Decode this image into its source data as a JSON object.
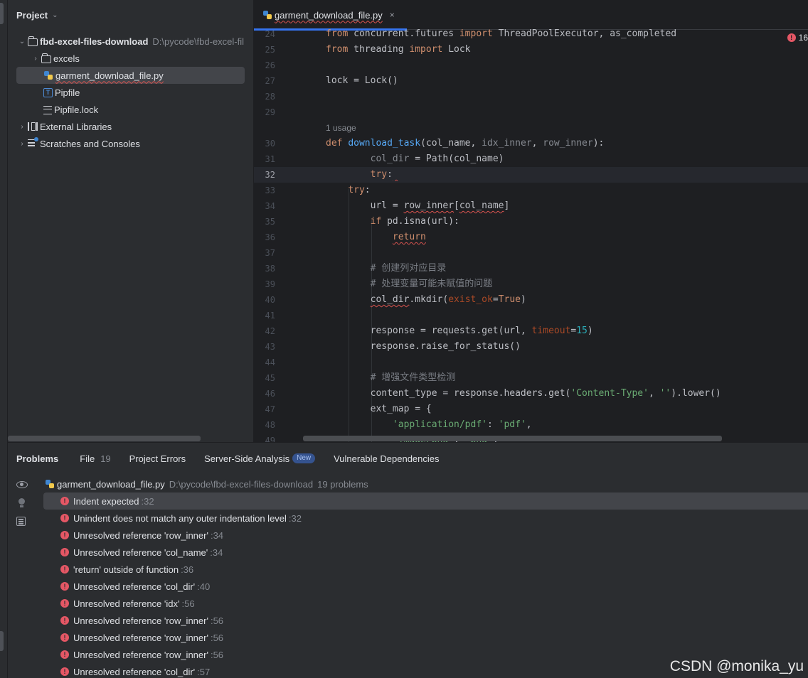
{
  "project": {
    "title": "Project",
    "root_name": "fbd-excel-files-download",
    "root_path": "D:\\pycode\\fbd-excel-fil",
    "items": [
      {
        "label": "excels"
      },
      {
        "label": "garment_download_file.py"
      },
      {
        "label": "Pipfile"
      },
      {
        "label": "Pipfile.lock"
      },
      {
        "label": "External Libraries"
      },
      {
        "label": "Scratches and Consoles"
      }
    ]
  },
  "editor": {
    "tab_label": "garment_download_file.py",
    "tab_close": "×",
    "error_count": "16",
    "usage_hint": "1 usage",
    "line_numbers": [
      "24",
      "25",
      "26",
      "27",
      "28",
      "29",
      "30",
      "31",
      "32",
      "33",
      "34",
      "35",
      "36",
      "37",
      "38",
      "39",
      "40",
      "41",
      "42",
      "43",
      "44",
      "45",
      "46",
      "47",
      "48",
      "49"
    ]
  },
  "problems": {
    "tabs": [
      {
        "label": "Problems"
      },
      {
        "label": "File",
        "count": "19"
      },
      {
        "label": "Project Errors"
      },
      {
        "label": "Server-Side Analysis",
        "badge": "New"
      },
      {
        "label": "Vulnerable Dependencies"
      }
    ],
    "file_name": "garment_download_file.py",
    "file_path": "D:\\pycode\\fbd-excel-files-download",
    "file_count": "19 problems",
    "items": [
      {
        "message": "Indent expected",
        "line": ":32"
      },
      {
        "message": "Unindent does not match any outer indentation level",
        "line": ":32"
      },
      {
        "message": "Unresolved reference 'row_inner'",
        "line": ":34"
      },
      {
        "message": "Unresolved reference 'col_name'",
        "line": ":34"
      },
      {
        "message": "'return' outside of function",
        "line": ":36"
      },
      {
        "message": "Unresolved reference 'col_dir'",
        "line": ":40"
      },
      {
        "message": "Unresolved reference 'idx'",
        "line": ":56"
      },
      {
        "message": "Unresolved reference 'row_inner'",
        "line": ":56"
      },
      {
        "message": "Unresolved reference 'row_inner'",
        "line": ":56"
      },
      {
        "message": "Unresolved reference 'row_inner'",
        "line": ":56"
      },
      {
        "message": "Unresolved reference 'col_dir'",
        "line": ":57"
      }
    ]
  },
  "watermark": "CSDN @monika_yu"
}
